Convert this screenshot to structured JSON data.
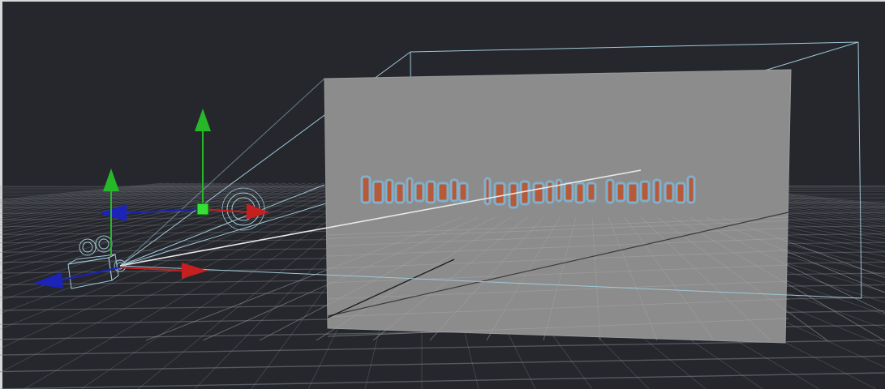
{
  "viewport": {
    "background": "#25272d",
    "grid_color": "#8a8d93",
    "camera_wire_color": "#9fc7d6",
    "image_plane_color": "#8c8c8c",
    "glyph_outline_color": "#7fb0cc",
    "glyph_fill_color": "#b75a3a"
  },
  "gizmo_colors": {
    "x_axis": "#c51f1f",
    "y_axis": "#27b82a",
    "z_axis": "#1b23b8",
    "pivot": "#36e036"
  },
  "icons": {
    "camera_object": "camera-icon",
    "target_gizmo": "transform-gizmo-icon"
  }
}
